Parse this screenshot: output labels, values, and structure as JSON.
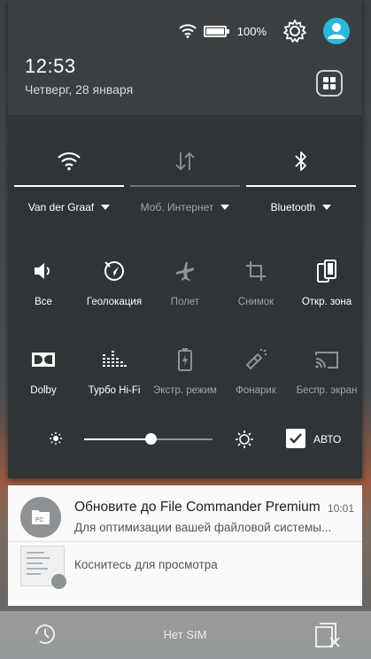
{
  "status": {
    "battery": "100%",
    "battery_level": 1.0
  },
  "header": {
    "time": "12:53",
    "date": "Четверг, 28 января"
  },
  "connectivity": [
    {
      "name": "wifi",
      "label": "Van der Graaf",
      "active": true
    },
    {
      "name": "mobile-data",
      "label": "Моб. Интернет",
      "active": false
    },
    {
      "name": "bluetooth",
      "label": "Bluetooth",
      "active": true
    }
  ],
  "tiles_row1": [
    {
      "label": "Все",
      "icon": "volume-icon",
      "active": true
    },
    {
      "label": "Геолокация",
      "icon": "location-icon",
      "active": true
    },
    {
      "label": "Полет",
      "icon": "airplane-icon",
      "active": false
    },
    {
      "label": "Снимок",
      "icon": "crop-icon",
      "active": false
    },
    {
      "label": "Откр. зона",
      "icon": "hotspot-icon",
      "active": true
    }
  ],
  "tiles_row2": [
    {
      "label": "Dolby",
      "icon": "dolby-icon",
      "active": true
    },
    {
      "label": "Турбо Hi-Fi",
      "icon": "equalizer-icon",
      "active": true
    },
    {
      "label": "Экстр. режим",
      "icon": "battery-saver-icon",
      "active": false
    },
    {
      "label": "Фонарик",
      "icon": "flashlight-icon",
      "active": false
    },
    {
      "label": "Беспр. экран",
      "icon": "cast-icon",
      "active": false
    }
  ],
  "brightness": {
    "level": 0.52,
    "auto_label": "АВТО",
    "auto_checked": true
  },
  "notifications": [
    {
      "title": "Обновите до File Commander Premium",
      "time": "10:01",
      "text": "Для оптимизации вашей файловой системы..."
    },
    {
      "text": "Коснитесь для просмотра"
    }
  ],
  "bottom": {
    "sim_text": "Нет SIM"
  },
  "colors": {
    "accent": "#27b9d9",
    "panel": "#2f3537"
  }
}
